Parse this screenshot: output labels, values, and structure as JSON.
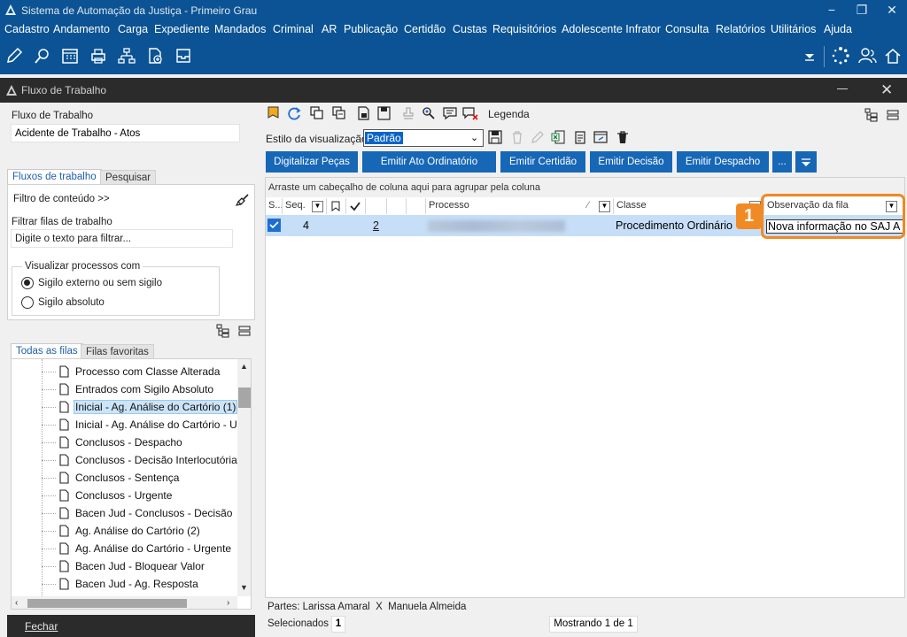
{
  "app": {
    "title": "Sistema de Automação da Justiça - Primeiro Grau",
    "window_buttons": [
      "−",
      "❐",
      "✕"
    ]
  },
  "menu": [
    "Cadastro",
    "Andamento",
    "Carga",
    "Expediente",
    "Mandados",
    "Criminal",
    "AR",
    "Publicação",
    "Certidão",
    "Custas",
    "Requisitórios",
    "Adolescente Infrator",
    "Consulta",
    "Relatórios",
    "Utilitários",
    "Ajuda"
  ],
  "inner_window": {
    "title": "Fluxo de Trabalho",
    "close": "✕"
  },
  "left": {
    "fluxo_label": "Fluxo de Trabalho",
    "fluxo_value": "Acidente de Trabalho - Atos",
    "tabs": [
      "Fluxos de trabalho",
      "Pesquisar"
    ],
    "filtro_conteudo": "Filtro de conteúdo >>",
    "filtrar_label": "Filtrar filas de trabalho",
    "filtrar_placeholder": "Digite o texto para filtrar...",
    "visualizar_title": "Visualizar processos com",
    "radio_options": [
      "Sigilo externo ou sem sigilo",
      "Sigilo absoluto"
    ],
    "queue_tabs": [
      "Todas as filas",
      "Filas favoritas"
    ],
    "queues": [
      "Processo com Classe Alterada",
      "Entrados com Sigilo Absoluto",
      "Inicial - Ag. Análise do Cartório (1)",
      "Inicial - Ag. Análise do Cartório - Urgente",
      "Conclusos - Despacho",
      "Conclusos - Decisão Interlocutória",
      "Conclusos - Sentença",
      "Conclusos - Urgente",
      "Bacen Jud - Conclusos - Decisão",
      "Ag. Análise do Cartório (2)",
      "Ag. Análise do Cartório - Urgente",
      "Bacen Jud - Bloquear Valor",
      "Bacen Jud - Ag. Resposta"
    ],
    "fechar": "Fechar"
  },
  "right": {
    "legenda": "Legenda",
    "estilo_label": "Estilo da visualização",
    "estilo_value": "Padrão",
    "buttons": [
      "Digitalizar Peças",
      "Emitir Ato Ordinatório",
      "Emitir Certidão",
      "Emitir Decisão",
      "Emitir Despacho",
      "..."
    ],
    "group_hint": "Arraste um cabeçalho de coluna aqui para agrupar pela coluna",
    "columns": [
      "S...",
      "Seq.",
      "",
      "",
      "",
      "",
      "Processo",
      "Classe",
      "Observação da fila"
    ],
    "row": {
      "seq": "4",
      "link": "2",
      "classe": "Procedimento Ordinário",
      "observacao": "Nova informação no SAJ A"
    },
    "callout_number": "1",
    "partes_label": "Partes:",
    "partes_value": "Larissa Amaral",
    "partes_sep": "X",
    "partes_value2": "Manuela Almeida",
    "selecionados_label": "Selecionados",
    "selecionados_value": "1",
    "mostrando": "Mostrando 1 de 1"
  },
  "colors": {
    "brand_blue": "#0b5394",
    "button_blue": "#1767b7",
    "highlight_orange": "#f08a24",
    "row_selected": "#c6def7"
  }
}
